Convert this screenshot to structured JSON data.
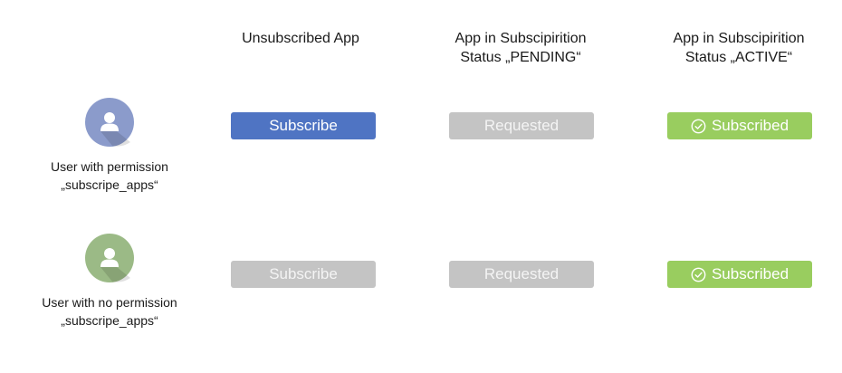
{
  "columns": [
    {
      "title": "Unsubscribed App"
    },
    {
      "title": "App in Subscipirition\nStatus „PENDING“"
    },
    {
      "title": "App in Subscipirition\nStatus „ACTIVE“"
    }
  ],
  "rows": [
    {
      "user_label": "User with permission\n„subscripe_apps“",
      "avatar_color": "#8b9bcb",
      "buttons": [
        {
          "label": "Subscribe",
          "color": "#4f74c3",
          "text_color": "#ffffff"
        },
        {
          "label": "Requested",
          "color": "#c4c4c4",
          "text_color": "#f4f4f4"
        },
        {
          "label": "Subscribed",
          "color": "#99cd5f",
          "text_color": "#ffffff",
          "icon": "check-circle-icon"
        }
      ]
    },
    {
      "user_label": "User with no permission\n„subscripe_apps“",
      "avatar_color": "#9bba86",
      "buttons": [
        {
          "label": "Subscribe",
          "color": "#c4c4c4",
          "text_color": "#f4f4f4"
        },
        {
          "label": "Requested",
          "color": "#c4c4c4",
          "text_color": "#f4f4f4"
        },
        {
          "label": "Subscribed",
          "color": "#99cd5f",
          "text_color": "#ffffff",
          "icon": "check-circle-icon"
        }
      ]
    }
  ]
}
